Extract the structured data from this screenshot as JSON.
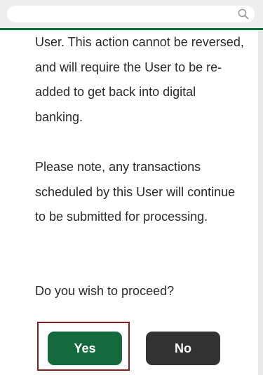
{
  "header": {
    "search_icon": "search-icon"
  },
  "dialog": {
    "paragraph_1": "User. This action cannot be reversed, and will require the User to be re-added to get back into digital banking.",
    "paragraph_2": "Please note, any transactions scheduled by this User will continue to be submitted for processing.",
    "paragraph_3": "Do you wish to proceed?",
    "yes_label": "Yes",
    "no_label": "No"
  },
  "colors": {
    "brand_green": "#146a3d",
    "header_line_green": "#0e6b3b",
    "no_button": "#333333",
    "highlight_border": "#8a1c1c"
  }
}
